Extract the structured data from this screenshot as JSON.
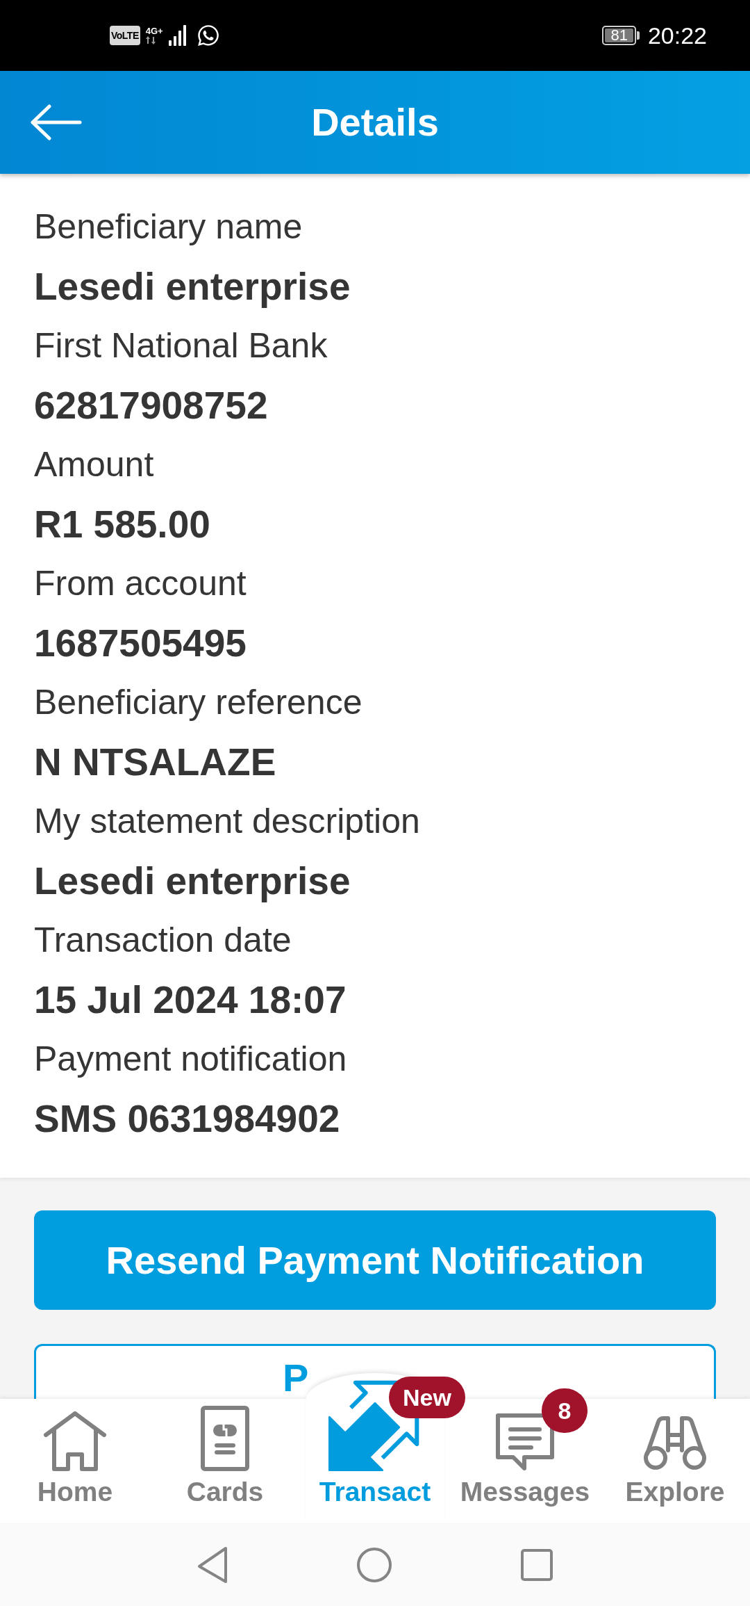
{
  "status_bar": {
    "volte": "VoLTE",
    "network": "4G+",
    "battery": "81",
    "time": "20:22"
  },
  "header": {
    "title": "Details"
  },
  "details": [
    {
      "label": "Beneficiary name",
      "value": "Lesedi enterprise"
    },
    {
      "label": "First National Bank",
      "value": "62817908752"
    },
    {
      "label": "Amount",
      "value": "R1 585.00"
    },
    {
      "label": "From account",
      "value": "1687505495"
    },
    {
      "label": "Beneficiary reference",
      "value": "N NTSALAZE"
    },
    {
      "label": "My statement description",
      "value": "Lesedi enterprise"
    },
    {
      "label": "Transaction date",
      "value": "15 Jul 2024 18:07"
    },
    {
      "label": "Payment notification",
      "value": "SMS 0631984902"
    }
  ],
  "buttons": [
    {
      "label": "Resend Payment Notification",
      "kind": "filled"
    },
    {
      "label": "P",
      "kind": "outline"
    }
  ],
  "bottom_nav": [
    {
      "label": "Home",
      "selected": false
    },
    {
      "label": "Cards",
      "selected": false
    },
    {
      "label": "Transact",
      "selected": true,
      "badge": {
        "text": "New",
        "kind": "pill"
      }
    },
    {
      "label": "Messages",
      "selected": false,
      "badge": {
        "text": "8",
        "kind": "count"
      }
    },
    {
      "label": "Explore",
      "selected": false
    }
  ]
}
